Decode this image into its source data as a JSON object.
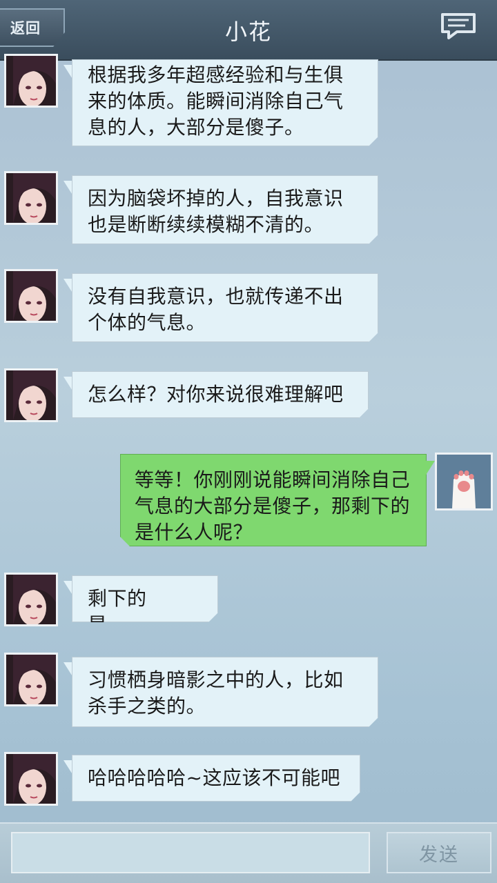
{
  "header": {
    "back_label": "返回",
    "title": "小花"
  },
  "messages": [
    {
      "sender": "小花",
      "text": "根据我多年超感经验和与生俱来的体质。能瞬间消除自己气息的人，大部分是傻子。"
    },
    {
      "sender": "小花",
      "text": "因为脑袋坏掉的人，自我意识也是断断续续模糊不清的。"
    },
    {
      "sender": "小花",
      "text": "没有自我意识，也就传递不出个体的气息。"
    },
    {
      "sender": "小花",
      "text": "怎么样？对你来说很难理解吧~"
    },
    {
      "sender": "me",
      "text": "等等！你刚刚说能瞬间消除自己气息的大部分是傻子，那剩下的是什么人呢？"
    },
    {
      "sender": "小花",
      "text": "剩下的是……"
    },
    {
      "sender": "小花",
      "text": "习惯栖身暗影之中的人，比如杀手之类的。"
    },
    {
      "sender": "小花",
      "text": "哈哈哈哈哈~这应该不可能吧~"
    }
  ],
  "composer": {
    "input_value": "",
    "send_label": "发送"
  },
  "colors": {
    "incoming_bubble": "#e3f2f8",
    "outgoing_bubble": "#7fd86f",
    "header": "#3f5262"
  }
}
